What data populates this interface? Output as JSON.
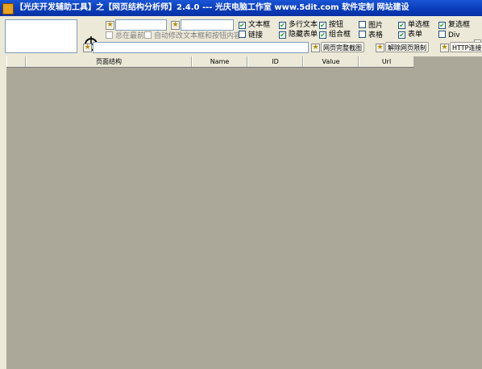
{
  "window": {
    "title": "【光庆开发辅助工具】之【网页结构分析师】2.4.0 --- 光庆电脑工作室  www.5dit.com  软件定制 网站建设"
  },
  "toolbar": {
    "crosshair_icon": "crosshair-target-icon",
    "star_icon": "star-icon",
    "always_on_top_label": "总在最前",
    "auto_modify_label": "自动修改文本框和按钮内容",
    "checkboxes": [
      {
        "label": "文本框",
        "checked": true
      },
      {
        "label": "多行文本",
        "checked": true
      },
      {
        "label": "按钮",
        "checked": true
      },
      {
        "label": "图片",
        "checked": false
      },
      {
        "label": "单选框",
        "checked": true
      },
      {
        "label": "复选框",
        "checked": true
      },
      {
        "label": "链接",
        "checked": false
      },
      {
        "label": "隐藏表单",
        "checked": true
      },
      {
        "label": "组合框",
        "checked": true
      },
      {
        "label": "表格",
        "checked": false
      },
      {
        "label": "表单",
        "checked": true
      },
      {
        "label": "Div",
        "checked": false
      }
    ],
    "btn_screenshot": "网页完整截图",
    "btn_remove_limit": "解除网页限制",
    "btn_http": "HTTP连接"
  },
  "table": {
    "columns": [
      "页面结构",
      "Name",
      "ID",
      "Value",
      "Url"
    ]
  },
  "colors": {
    "title_bar": "#0a3bb8",
    "grid_bg": "#aca899",
    "window_bg": "#ece9d8"
  }
}
